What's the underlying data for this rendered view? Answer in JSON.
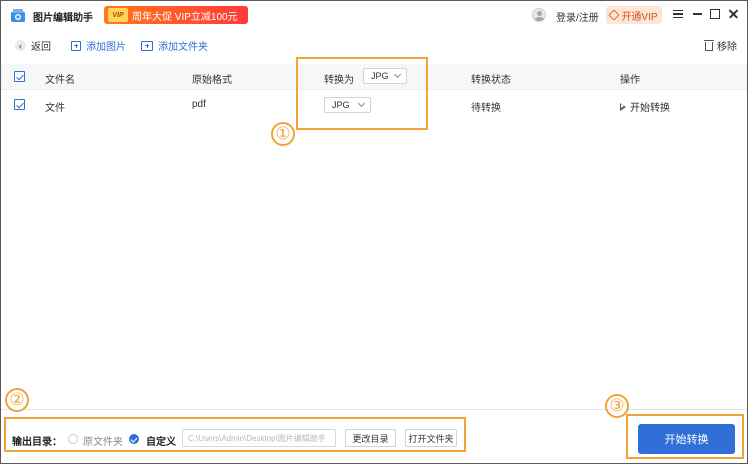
{
  "app": {
    "title": "图片编辑助手"
  },
  "promo": {
    "badge": "VIP",
    "text": "周年大促 VIP立减100元"
  },
  "header": {
    "login_label": "登录/注册",
    "vip_label": "开通VIP"
  },
  "toolbar": {
    "back_label": "返回",
    "add_image_label": "添加图片",
    "add_folder_label": "添加文件夹",
    "remove_label": "移除"
  },
  "table": {
    "columns": {
      "filename": "文件名",
      "original_format": "原始格式",
      "convert_to": "转换为",
      "status": "转换状态",
      "action": "操作"
    },
    "header_format_select": "JPG",
    "rows": [
      {
        "filename": "文件",
        "original_format": "pdf",
        "target_format": "JPG",
        "status": "待转换",
        "action": "开始转换"
      }
    ]
  },
  "annotations": {
    "one": "①",
    "two": "②",
    "three": "③"
  },
  "footer": {
    "output_label": "输出目录：",
    "option_original": "原文件夹",
    "option_custom": "自定义",
    "path_value": "C:\\Users\\Admin\\Desktop\\图片编辑助手",
    "change_dir_label": "更改目录",
    "open_folder_label": "打开文件夹",
    "start_label": "开始转换"
  },
  "colors": {
    "accent": "#2f6fd6",
    "annotation": "#f2a23a",
    "vip": "#d2521b"
  }
}
